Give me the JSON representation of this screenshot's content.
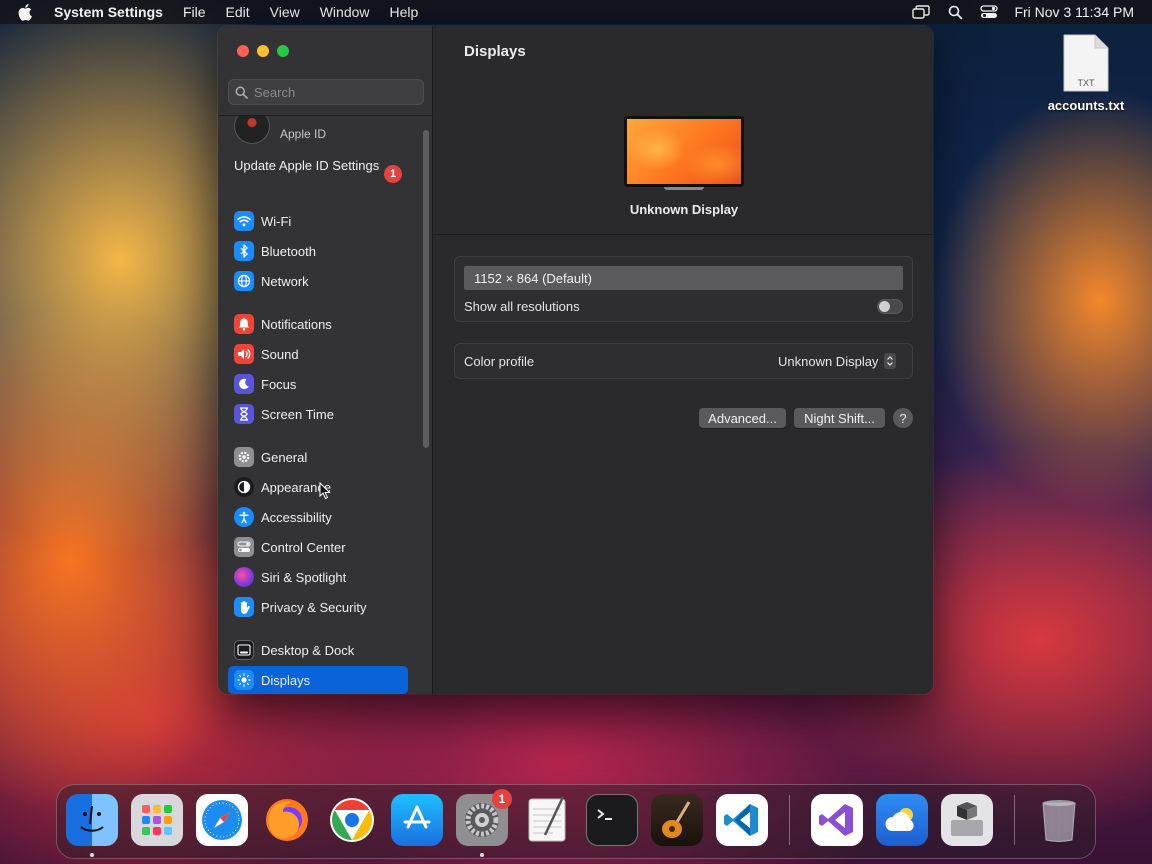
{
  "menubar": {
    "app_name": "System Settings",
    "menus": [
      "File",
      "Edit",
      "View",
      "Window",
      "Help"
    ],
    "clock": "Fri Nov 3  11:34 PM"
  },
  "desktop": {
    "file_name": "accounts.txt",
    "file_type": "TXT"
  },
  "sidebar": {
    "search_placeholder": "Search",
    "apple_id_label": "Apple ID",
    "update_label": "Update Apple ID Settings",
    "update_badge": "1",
    "items": [
      {
        "label": "Wi-Fi",
        "icon": "wifi-icon",
        "color": "#1a8cff"
      },
      {
        "label": "Bluetooth",
        "icon": "bluetooth-icon",
        "color": "#1a8cff"
      },
      {
        "label": "Network",
        "icon": "globe-icon",
        "color": "#1a8cff"
      },
      {
        "label": "Notifications",
        "icon": "bell-icon",
        "color": "#f0443a"
      },
      {
        "label": "Sound",
        "icon": "speaker-icon",
        "color": "#f0443a"
      },
      {
        "label": "Focus",
        "icon": "moon-icon",
        "color": "#5a55d6"
      },
      {
        "label": "Screen Time",
        "icon": "hourglass-icon",
        "color": "#5a55d6"
      },
      {
        "label": "General",
        "icon": "gear-icon",
        "color": "#8e8e93"
      },
      {
        "label": "Appearance",
        "icon": "appearance-icon",
        "color": "#1c1c1e"
      },
      {
        "label": "Accessibility",
        "icon": "accessibility-icon",
        "color": "#1a8cff"
      },
      {
        "label": "Control Center",
        "icon": "control-center-icon",
        "color": "#8e8e93"
      },
      {
        "label": "Siri & Spotlight",
        "icon": "siri-icon",
        "color": "#8a3ad6"
      },
      {
        "label": "Privacy & Security",
        "icon": "hand-icon",
        "color": "#1a8cff"
      },
      {
        "label": "Desktop & Dock",
        "icon": "dock-icon",
        "color": "#1c1c1e"
      },
      {
        "label": "Displays",
        "icon": "sun-icon",
        "color": "#1a8cff"
      }
    ]
  },
  "main": {
    "title": "Displays",
    "display_name": "Unknown Display",
    "resolution": "1152 × 864 (Default)",
    "show_all_label": "Show all resolutions",
    "show_all_on": false,
    "color_profile_label": "Color profile",
    "color_profile_value": "Unknown Display",
    "advanced_label": "Advanced...",
    "night_shift_label": "Night Shift...",
    "help_label": "?"
  },
  "dock": {
    "settings_badge": "1",
    "apps": [
      "Finder",
      "Launchpad",
      "Safari",
      "Firefox",
      "Chrome",
      "App Store",
      "System Settings",
      "TextEdit",
      "Terminal",
      "GarageBand",
      "VS Code",
      "Visual Studio",
      "Weather",
      "Boot Camp",
      "Trash"
    ]
  }
}
